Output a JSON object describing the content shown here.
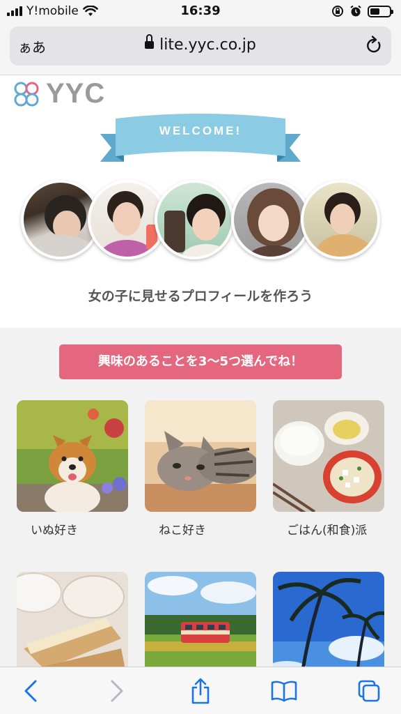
{
  "status_bar": {
    "carrier": "Y!mobile",
    "time": "16:39"
  },
  "address_bar": {
    "text_size_label": "ぁあ",
    "url": "lite.yyc.co.jp"
  },
  "site": {
    "logo_text": "YYC",
    "welcome_banner": "WELCOME!",
    "hero_caption": "女の子に見せるプロフィールを作ろう",
    "prompt_button": "興味のあることを3〜5つ選んでね！"
  },
  "interests": [
    {
      "label": "いぬ好き"
    },
    {
      "label": "ねこ好き"
    },
    {
      "label": "ごはん(和食)派"
    },
    {
      "label": ""
    },
    {
      "label": ""
    },
    {
      "label": ""
    }
  ],
  "toolbar": {
    "items": [
      "back-icon",
      "forward-icon",
      "share-icon",
      "bookmarks-icon",
      "tabs-icon"
    ]
  },
  "colors": {
    "accent_pink": "#e5677f",
    "ribbon_blue": "#7cc0dd",
    "ios_blue": "#1a73e8"
  }
}
